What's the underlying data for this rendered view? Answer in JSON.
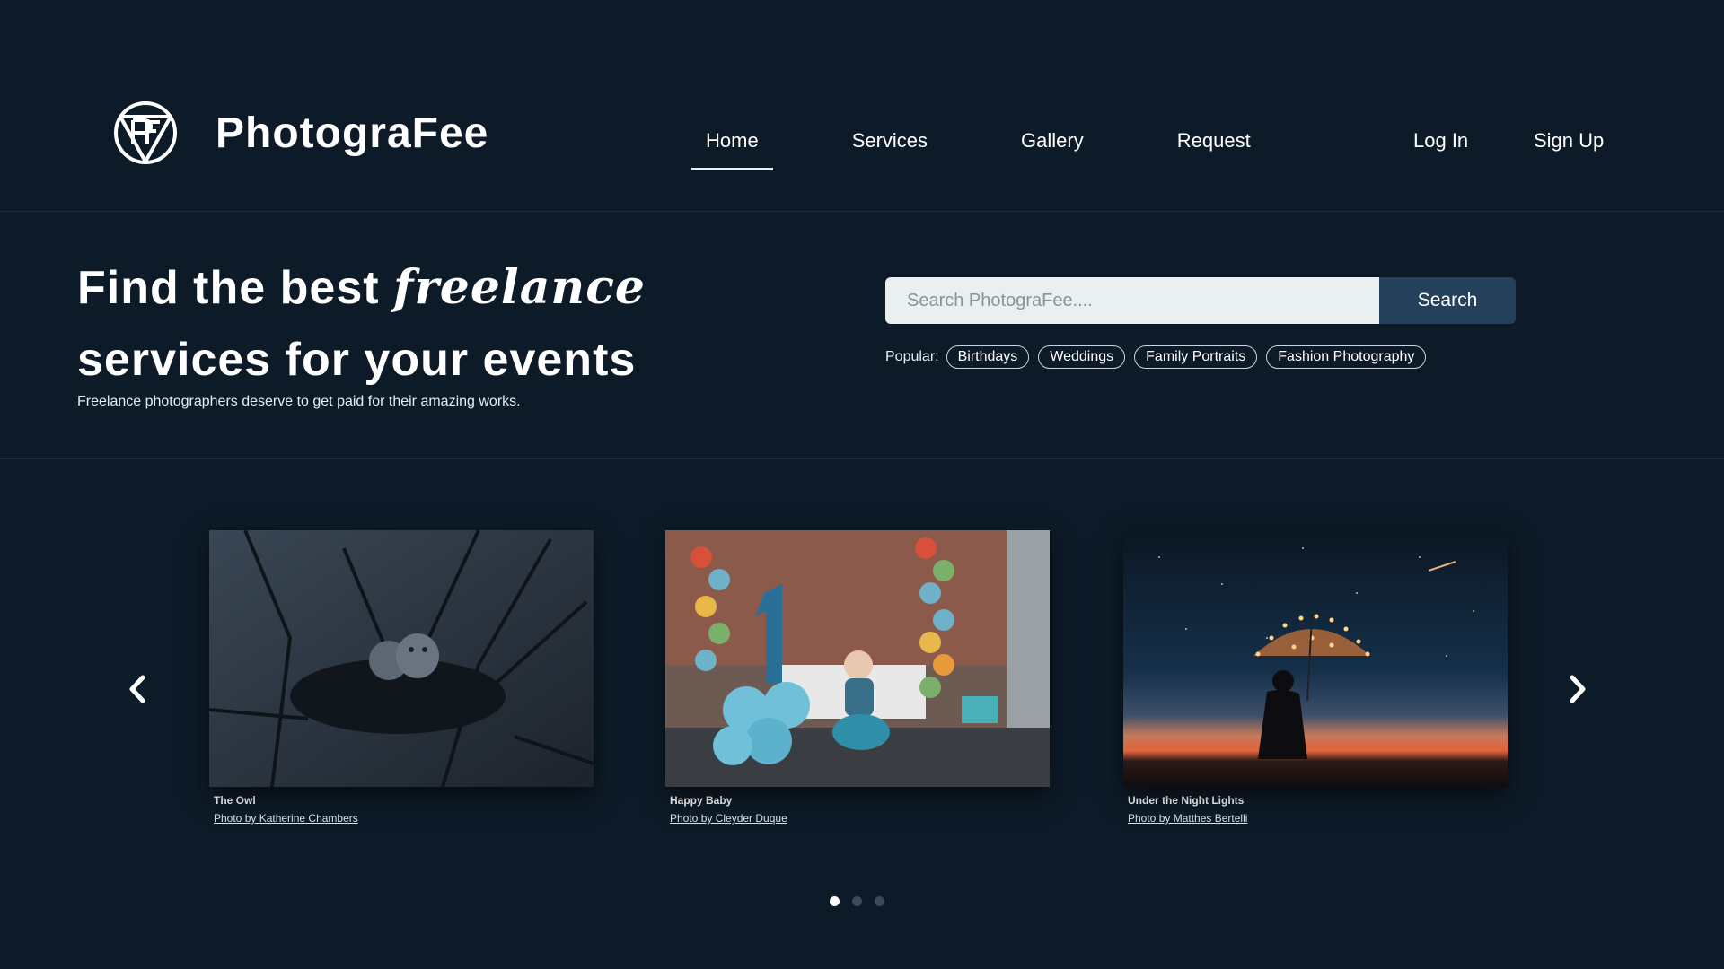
{
  "brand": {
    "name": "PhotograFee",
    "logo_icon": "pf-triangle-logo-icon"
  },
  "nav": {
    "items": [
      {
        "label": "Home",
        "active": true
      },
      {
        "label": "Services",
        "active": false
      },
      {
        "label": "Gallery",
        "active": false
      },
      {
        "label": "Request",
        "active": false
      }
    ]
  },
  "auth": {
    "login_label": "Log In",
    "signup_label": "Sign Up"
  },
  "hero": {
    "title_part1": "Find the best ",
    "title_accent": "freelance",
    "title_part2": "services for your events",
    "subtitle": "Freelance photographers deserve to get paid for their amazing works."
  },
  "search": {
    "placeholder": "Search PhotograFee....",
    "value": "",
    "button_label": "Search",
    "popular_label": "Popular:",
    "popular_tags": [
      "Birthdays",
      "Weddings",
      "Family Portraits",
      "Fashion Photography"
    ]
  },
  "carousel": {
    "prev_icon": "chevron-left-icon",
    "next_icon": "chevron-right-icon",
    "cards": [
      {
        "title": "The Owl",
        "credit": "Photo by Katherine Chambers"
      },
      {
        "title": "Happy Baby",
        "credit": "Photo by Cleyder Duque"
      },
      {
        "title": "Under the Night Lights",
        "credit": "Photo by Matthes Bertelli"
      }
    ],
    "dots": 3,
    "active_dot": 0
  },
  "colors": {
    "background": "#0d1b28",
    "search_button": "#25405a",
    "search_input": "#eaf0ef",
    "text": "#ffffff"
  }
}
